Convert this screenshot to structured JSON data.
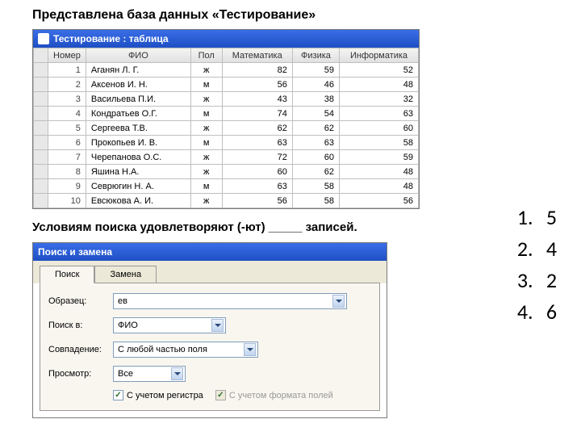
{
  "heading": "Представлена база данных «Тестирование»",
  "subtext": "Условиям поиска удовлетворяют (-ют) _____ записей.",
  "table": {
    "title": "Тестирование : таблица",
    "columns": [
      "Номер",
      "ФИО",
      "Пол",
      "Математика",
      "Физика",
      "Информатика"
    ],
    "rows": [
      {
        "n": "1",
        "fio": "Аганян Л. Г.",
        "sex": "ж",
        "m": "82",
        "p": "59",
        "i": "52"
      },
      {
        "n": "2",
        "fio": "Аксенов И. Н.",
        "sex": "м",
        "m": "56",
        "p": "46",
        "i": "48"
      },
      {
        "n": "3",
        "fio": "Васильева П.И.",
        "sex": "ж",
        "m": "43",
        "p": "38",
        "i": "32"
      },
      {
        "n": "4",
        "fio": "Кондратьев О.Г.",
        "sex": "м",
        "m": "74",
        "p": "54",
        "i": "63"
      },
      {
        "n": "5",
        "fio": "Сергеева Т.В.",
        "sex": "ж",
        "m": "62",
        "p": "62",
        "i": "60"
      },
      {
        "n": "6",
        "fio": "Прокопьев И. В.",
        "sex": "м",
        "m": "63",
        "p": "63",
        "i": "58"
      },
      {
        "n": "7",
        "fio": "Черепанова О.С.",
        "sex": "ж",
        "m": "72",
        "p": "60",
        "i": "59"
      },
      {
        "n": "8",
        "fio": "Яшина Н.А.",
        "sex": "ж",
        "m": "60",
        "p": "62",
        "i": "48"
      },
      {
        "n": "9",
        "fio": "Севрюгин Н. А.",
        "sex": "м",
        "m": "63",
        "p": "58",
        "i": "48"
      },
      {
        "n": "10",
        "fio": "Евсюкова А. И.",
        "sex": "ж",
        "m": "56",
        "p": "58",
        "i": "56"
      }
    ]
  },
  "dialog": {
    "title": "Поиск и замена",
    "tabs": {
      "search": "Поиск",
      "replace": "Замена"
    },
    "fields": {
      "sample_label": "Образец:",
      "sample_value": "ев",
      "searchin_label": "Поиск в:",
      "searchin_value": "ФИО",
      "match_label": "Совпадение:",
      "match_value": "С любой частью поля",
      "view_label": "Просмотр:",
      "view_value": "Все",
      "cb_case": "С учетом регистра",
      "cb_format": "С учетом формата полей"
    }
  },
  "answers": [
    {
      "num": "1.",
      "val": "5"
    },
    {
      "num": "2.",
      "val": "4"
    },
    {
      "num": "3.",
      "val": "2"
    },
    {
      "num": "4.",
      "val": "6"
    }
  ]
}
